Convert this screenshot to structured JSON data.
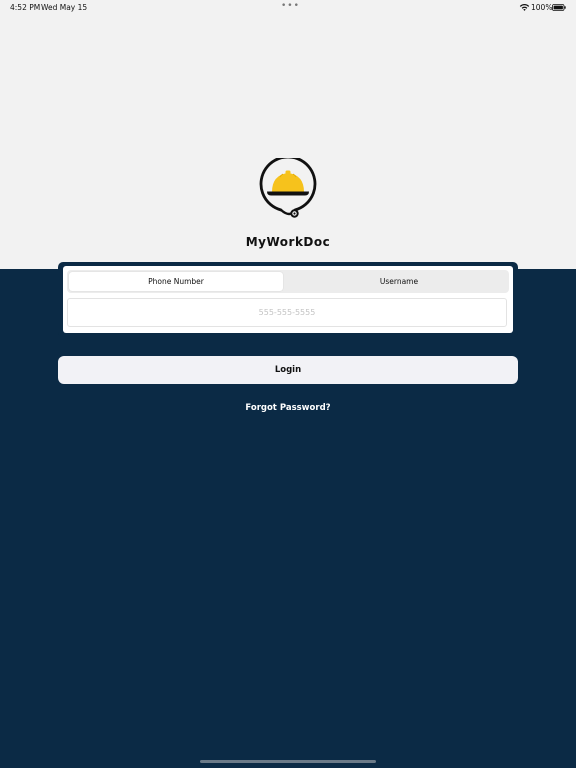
{
  "status_bar": {
    "time": "4:52 PM",
    "date": "Wed May 15",
    "dots": "•••",
    "battery": "100%",
    "wifi_icon": "wifi-icon",
    "battery_icon": "battery-icon"
  },
  "app": {
    "title": "MyWorkDoc",
    "logo_icon": "hardhat-stethoscope-logo"
  },
  "login_form": {
    "tabs": [
      {
        "label": "Phone Number",
        "selected": true
      },
      {
        "label": "Username",
        "selected": false
      }
    ],
    "phone_input": {
      "value": "",
      "placeholder": "555-555-5555"
    },
    "login_label": "Login",
    "forgot_label": "Forgot Password?"
  },
  "colors": {
    "background_top": "#f2f2f2",
    "background_bottom": "#0b2a45",
    "hardhat": "#f6c21c",
    "button": "#f2f2f6"
  }
}
